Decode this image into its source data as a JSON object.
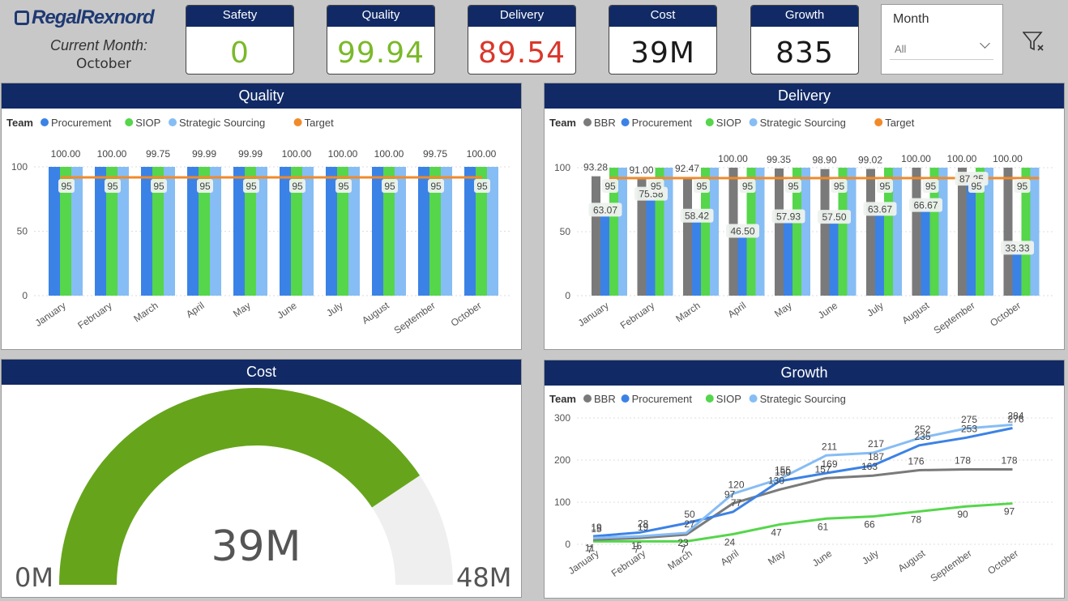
{
  "header": {
    "logo_text": "RegalRexnord",
    "current_month_label": "Current Month:",
    "current_month_value": "October"
  },
  "kpis": [
    {
      "label": "Safety",
      "value": "0",
      "color": "#7ab929"
    },
    {
      "label": "Quality",
      "value": "99.94",
      "color": "#7ab929"
    },
    {
      "label": "Delivery",
      "value": "89.54",
      "color": "#d9372b"
    },
    {
      "label": "Cost",
      "value": "39M",
      "color": "#1a1a1a"
    },
    {
      "label": "Growth",
      "value": "835",
      "color": "#1a1a1a"
    }
  ],
  "slicer": {
    "label": "Month",
    "value": "All"
  },
  "icons": {
    "filter": "clear-filter-icon",
    "info": "info-icon"
  },
  "colors": {
    "BBR": "#7a7a7a",
    "Procurement": "#3b82e6",
    "SIOP": "#55d64b",
    "Strategic Sourcing": "#86bdf4",
    "Target": "#f28a2a",
    "gauge_fill": "#66a51b",
    "gauge_bg": "#efefef",
    "header": "#112a66"
  },
  "months": [
    "January",
    "February",
    "March",
    "April",
    "May",
    "June",
    "July",
    "August",
    "September",
    "October"
  ],
  "panels": {
    "quality": "Quality",
    "delivery": "Delivery",
    "cost": "Cost",
    "growth": "Growth"
  },
  "chart_data": [
    {
      "type": "bar",
      "title": "Quality",
      "legend_title": "Team",
      "categories": [
        "January",
        "February",
        "March",
        "April",
        "May",
        "June",
        "July",
        "August",
        "September",
        "October"
      ],
      "series": [
        {
          "name": "Procurement",
          "values": [
            100,
            100,
            100,
            100,
            100,
            100,
            100,
            100,
            100,
            100
          ]
        },
        {
          "name": "SIOP",
          "values": [
            100,
            100,
            100,
            100,
            100,
            100,
            100,
            100,
            100,
            100
          ]
        },
        {
          "name": "Strategic Sourcing",
          "values": [
            100,
            100,
            100,
            100,
            100,
            100,
            100,
            100,
            100,
            100
          ]
        }
      ],
      "target": {
        "name": "Target",
        "values": [
          95,
          95,
          95,
          95,
          95,
          95,
          95,
          95,
          95,
          95
        ]
      },
      "top_labels": [
        "100.00",
        "100.00",
        "99.75",
        "99.99",
        "99.99",
        "100.00",
        "100.00",
        "100.00",
        "99.75",
        "100.00"
      ],
      "yticks": [
        0,
        50,
        100
      ],
      "ylim": [
        0,
        100
      ]
    },
    {
      "type": "bar",
      "title": "Delivery",
      "legend_title": "Team",
      "categories": [
        "January",
        "February",
        "March",
        "April",
        "May",
        "June",
        "July",
        "August",
        "September",
        "October"
      ],
      "series": [
        {
          "name": "BBR",
          "values": [
            93.28,
            91.0,
            92.47,
            100,
            99.35,
            98.9,
            99.02,
            100,
            100,
            100
          ]
        },
        {
          "name": "Procurement",
          "values": [
            63.07,
            75.58,
            58.42,
            46.5,
            57.93,
            57.5,
            63.67,
            66.67,
            87.25,
            33.33
          ]
        },
        {
          "name": "SIOP",
          "values": [
            100,
            100,
            100,
            100,
            100,
            100,
            100,
            100,
            100,
            100
          ]
        },
        {
          "name": "Strategic Sourcing",
          "values": [
            100,
            100,
            100,
            100,
            100,
            100,
            100,
            100,
            100,
            100
          ]
        }
      ],
      "target": {
        "name": "Target",
        "values": [
          95,
          95,
          95,
          95,
          95,
          95,
          95,
          95,
          95,
          95
        ]
      },
      "top_labels": [
        "93.28",
        "91.00",
        "92.47",
        "100.00",
        "99.35",
        "98.90",
        "99.02",
        "100.00",
        "100.00",
        "100.00"
      ],
      "proc_labels": [
        "63.07",
        "75.58",
        "58.42",
        "46.50",
        "57.93",
        "57.50",
        "63.67",
        "66.67",
        "87.25",
        "33.33"
      ],
      "yticks": [
        0,
        50,
        100
      ],
      "ylim": [
        0,
        100
      ]
    },
    {
      "type": "gauge",
      "title": "Cost",
      "value": 39,
      "min": 0,
      "max": 48,
      "value_label": "39M",
      "min_label": "0M",
      "max_label": "48M"
    },
    {
      "type": "line",
      "title": "Growth",
      "legend_title": "Team",
      "categories": [
        "January",
        "February",
        "March",
        "April",
        "May",
        "June",
        "July",
        "August",
        "September",
        "October"
      ],
      "series": [
        {
          "name": "BBR",
          "values": [
            11,
            15,
            23,
            97,
            130,
            157,
            163,
            176,
            178,
            178
          ]
        },
        {
          "name": "Procurement",
          "values": [
            19,
            28,
            50,
            77,
            150,
            169,
            187,
            235,
            253,
            276
          ]
        },
        {
          "name": "SIOP",
          "values": [
            7,
            7,
            7,
            24,
            47,
            61,
            66,
            78,
            90,
            97
          ]
        },
        {
          "name": "Strategic Sourcing",
          "values": [
            15,
            19,
            27,
            120,
            155,
            211,
            217,
            252,
            275,
            284
          ]
        }
      ],
      "yticks": [
        0,
        100,
        200,
        300
      ],
      "ylim": [
        0,
        300
      ]
    }
  ]
}
